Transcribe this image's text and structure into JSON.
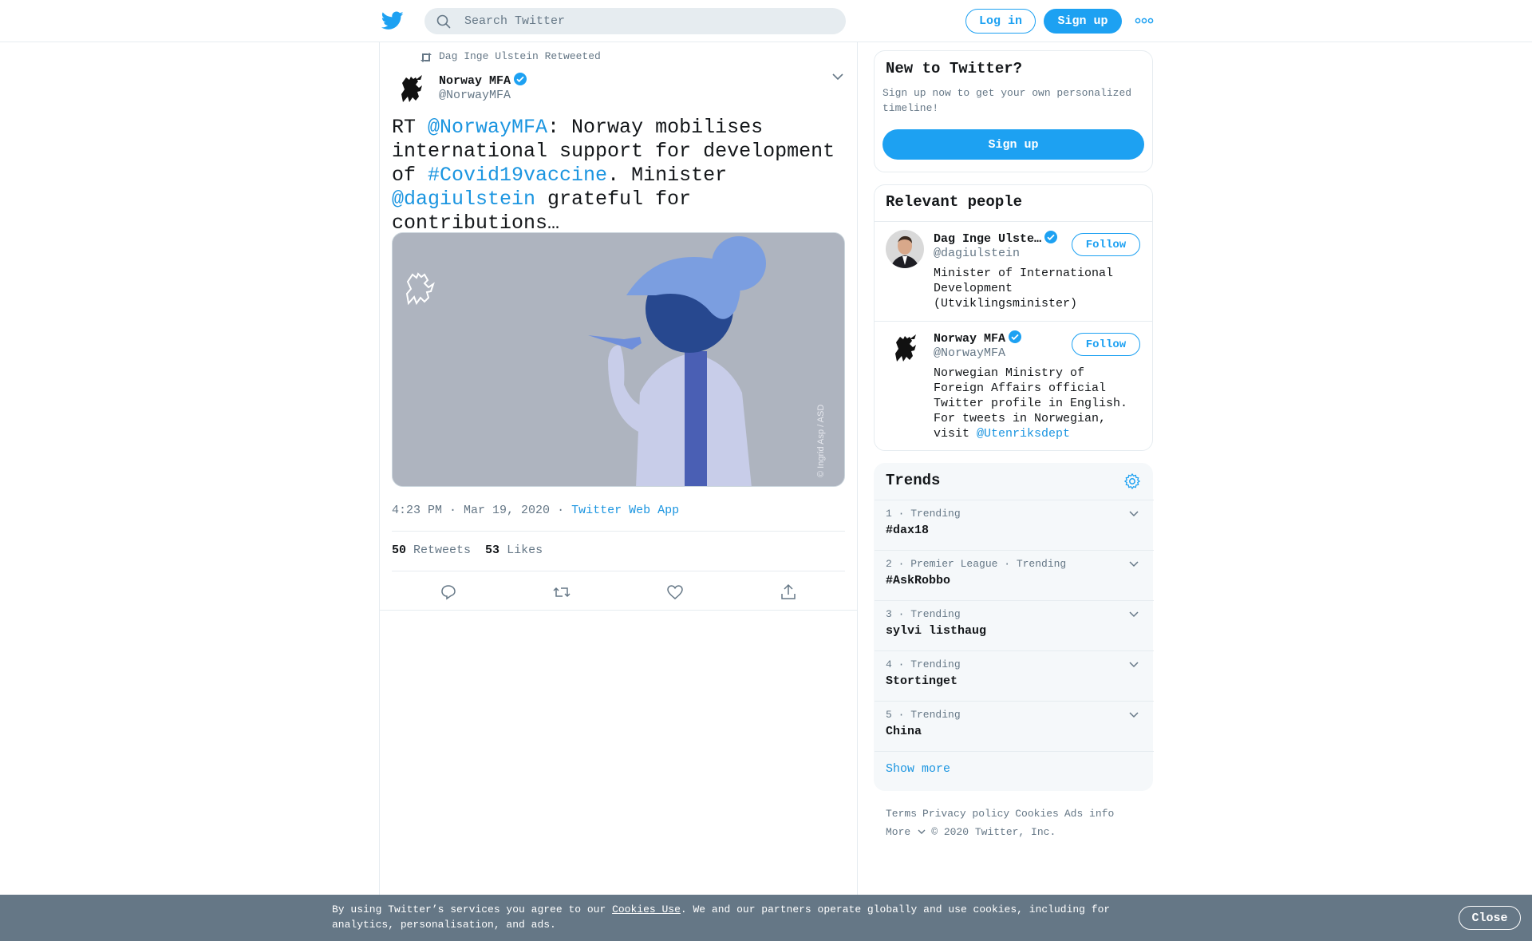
{
  "header": {
    "search_placeholder": "Search Twitter",
    "login_label": "Log in",
    "signup_label": "Sign up"
  },
  "tweet": {
    "retweeted_by": "Dag Inge Ulstein Retweeted",
    "author_name": "Norway MFA",
    "author_handle": "@NorwayMFA",
    "text_parts": {
      "p1": "RT ",
      "p2": "@NorwayMFA",
      "p3": ": Norway mobilises international support for development of ",
      "p4": "#Covid19vaccine",
      "p5": ". Minister ",
      "p6": "@dagiulstein",
      "p7": " grateful for contributions…"
    },
    "media_credit": "© Ingrid Asp / ASD",
    "timestamp": "4:23 PM · Mar 19, 2020",
    "source_sep": "·",
    "source": "Twitter Web App",
    "retweets_count": "50",
    "retweets_label": "Retweets",
    "likes_count": "53",
    "likes_label": "Likes",
    "actions": [
      "reply-icon",
      "retweet-icon",
      "like-icon",
      "share-icon"
    ]
  },
  "sidebar": {
    "new_to_twitter": {
      "title": "New to Twitter?",
      "description": "Sign up now to get your own personalized timeline!",
      "button_label": "Sign up"
    },
    "relevant_people": {
      "title": "Relevant people",
      "people": [
        {
          "name": "Dag Inge Ulste…",
          "handle": "@dagiulstein",
          "bio": "Minister of International Development (Utviklingsminister)",
          "follow_label": "Follow"
        },
        {
          "name": "Norway MFA",
          "handle": "@NorwayMFA",
          "bio_text": "Norwegian Ministry of Foreign Affairs official Twitter profile in English. For tweets in Norwegian, visit ",
          "bio_link": "@Utenriksdept",
          "follow_label": "Follow"
        }
      ]
    },
    "trends": {
      "title": "Trends",
      "items": [
        {
          "meta": "1 · Trending",
          "name": "#dax18"
        },
        {
          "meta": "2 · Premier League · Trending",
          "name": "#AskRobbo"
        },
        {
          "meta": "3 · Trending",
          "name": "sylvi listhaug"
        },
        {
          "meta": "4 · Trending",
          "name": "Stortinget"
        },
        {
          "meta": "5 · Trending",
          "name": "China"
        }
      ],
      "show_more": "Show more"
    },
    "footer": {
      "links": [
        "Terms",
        "Privacy policy",
        "Cookies",
        "Ads info"
      ],
      "more": "More",
      "copyright": "© 2020 Twitter, Inc."
    }
  },
  "cookie_bar": {
    "text_before": "By using Twitter’s services you agree to our ",
    "link": "Cookies Use",
    "text_after": ". We and our partners operate globally and use cookies, including for analytics, personalisation, and ads.",
    "close_label": "Close"
  },
  "colors": {
    "accent": "#1da1f2",
    "link": "#1b95e0",
    "muted": "#657786",
    "cookie_bar": "#657786"
  }
}
